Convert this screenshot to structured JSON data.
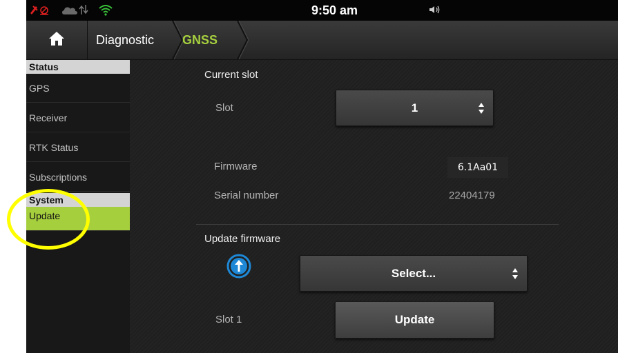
{
  "statusbar": {
    "time": "9:50 am",
    "icons": [
      "no-gps-icon",
      "cloud-icon",
      "data-transfer-icon",
      "wifi-icon",
      "volume-icon"
    ]
  },
  "header": {
    "home_icon": "home-icon",
    "breadcrumb": [
      "Diagnostic",
      "GNSS"
    ]
  },
  "sidebar": {
    "sections": [
      {
        "title": "Status",
        "items": [
          "GPS",
          "Receiver",
          "RTK Status",
          "Subscriptions"
        ]
      },
      {
        "title": "System",
        "items": [
          "Update"
        ]
      }
    ],
    "active_item": "Update"
  },
  "main": {
    "current_slot_title": "Current slot",
    "slot_label": "Slot",
    "slot_value": "1",
    "firmware_label": "Firmware",
    "firmware_value": "6.1Aa01",
    "serial_label": "Serial number",
    "serial_value": "22404179",
    "update_firmware_title": "Update firmware",
    "firmware_select_value": "Select...",
    "update_slot_label": "Slot 1",
    "update_button": "Update"
  },
  "colors": {
    "accent": "#a6cf3e",
    "highlight_ring": "#ffff00",
    "upload_icon": "#1e88d6"
  }
}
